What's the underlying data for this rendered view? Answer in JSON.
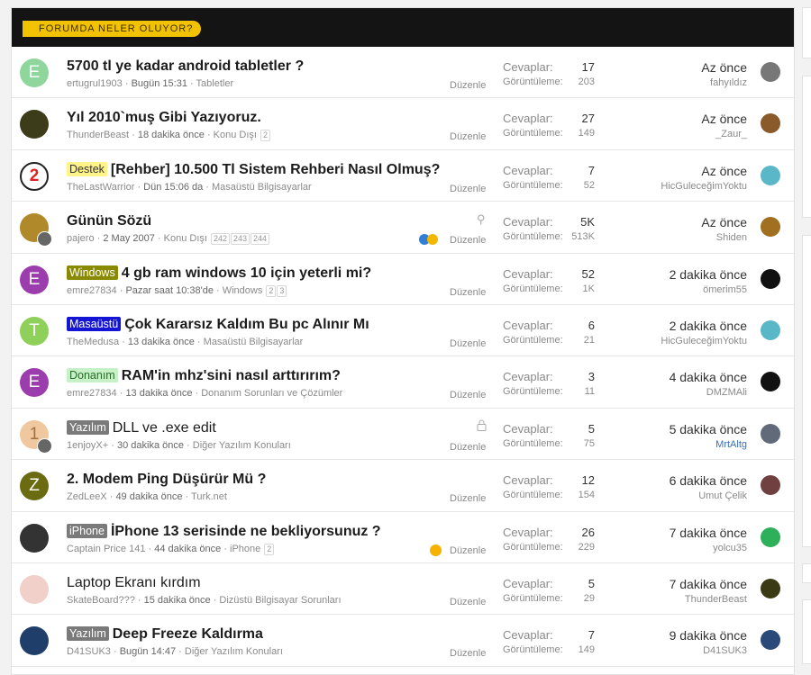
{
  "header": {
    "title": "FORUMDA NELER OLUYOR?"
  },
  "labels": {
    "replies": "Cevaplar:",
    "views": "Görüntüleme:",
    "edit": "Düzenle"
  },
  "threads": [
    {
      "prefix": "",
      "title": "5700 tl ye kadar android tabletler ?",
      "author": "ertugrul1903",
      "when": "Bugün 15:31",
      "forum": "Tabletler",
      "pages": [],
      "replies": "17",
      "views": "203",
      "last_time": "Az önce",
      "last_user": "fahyıldız",
      "avatar_letter": "E"
    },
    {
      "prefix": "",
      "title": "Yıl 2010`muş Gibi Yazıyoruz.",
      "author": "ThunderBeast",
      "when": "18 dakika önce",
      "forum": "Konu Dışı",
      "pages": [
        "2"
      ],
      "replies": "27",
      "views": "149",
      "last_time": "Az önce",
      "last_user": "_Zaur_",
      "avatar_letter": ""
    },
    {
      "prefix": "Destek",
      "title": "[Rehber] 10.500 Tl Sistem Rehberi Nasıl Olmuş?",
      "author": "TheLastWarrior",
      "when": "Dün 15:06 da",
      "forum": "Masaüstü Bilgisayarlar",
      "pages": [],
      "replies": "7",
      "views": "52",
      "last_time": "Az önce",
      "last_user": "HicGuleceğimYoktu",
      "avatar_letter": "2"
    },
    {
      "prefix": "",
      "title": "Günün Sözü",
      "author": "pajero",
      "when": "2 May 2007",
      "forum": "Konu Dışı",
      "pages": [
        "242",
        "243",
        "244"
      ],
      "replies": "5K",
      "views": "513K",
      "last_time": "Az önce",
      "last_user": "Shiden",
      "avatar_letter": ""
    },
    {
      "prefix": "Windows",
      "title": "4 gb ram windows 10 için yeterli mi?",
      "author": "emre27834",
      "when": "Pazar saat 10:38'de",
      "forum": "Windows",
      "pages": [
        "2",
        "3"
      ],
      "replies": "52",
      "views": "1K",
      "last_time": "2 dakika önce",
      "last_user": "ömerim55",
      "avatar_letter": "E"
    },
    {
      "prefix": "Masaüstü",
      "title": "Çok Kararsız Kaldım Bu pc Alınır Mı",
      "author": "TheMedusa",
      "when": "13 dakika önce",
      "forum": "Masaüstü Bilgisayarlar",
      "pages": [],
      "replies": "6",
      "views": "21",
      "last_time": "2 dakika önce",
      "last_user": "HicGuleceğimYoktu",
      "avatar_letter": "T"
    },
    {
      "prefix": "Donanım",
      "title": "RAM'in mhz'sini nasıl arttırırım?",
      "author": "emre27834",
      "when": "13 dakika önce",
      "forum": "Donanım Sorunları ve Çözümler",
      "pages": [],
      "replies": "3",
      "views": "11",
      "last_time": "4 dakika önce",
      "last_user": "DMZMAli",
      "avatar_letter": "E"
    },
    {
      "prefix": "Yazılım",
      "title": "DLL ve .exe edit",
      "author": "1enjoyX+",
      "when": "30 dakika önce",
      "forum": "Diğer Yazılım Konuları",
      "pages": [],
      "replies": "5",
      "views": "75",
      "last_time": "5 dakika önce",
      "last_user": "MrtAltg",
      "avatar_letter": "1"
    },
    {
      "prefix": "",
      "title": "2. Modem Ping Düşürür Mü ?",
      "author": "ZedLeeX",
      "when": "49 dakika önce",
      "forum": "Turk.net",
      "pages": [],
      "replies": "12",
      "views": "154",
      "last_time": "6 dakika önce",
      "last_user": "Umut Çelik",
      "avatar_letter": "Z"
    },
    {
      "prefix": "iPhone",
      "title": "İPhone 13 serisinde ne bekliyorsunuz ?",
      "author": "Captain Price 141",
      "when": "44 dakika önce",
      "forum": "iPhone",
      "pages": [
        "2"
      ],
      "replies": "26",
      "views": "229",
      "last_time": "7 dakika önce",
      "last_user": "yolcu35",
      "avatar_letter": ""
    },
    {
      "prefix": "",
      "title": "Laptop Ekranı kırdım",
      "author": "SkateBoard???",
      "when": "15 dakika önce",
      "forum": "Dizüstü Bilgisayar Sorunları",
      "pages": [],
      "replies": "5",
      "views": "29",
      "last_time": "7 dakika önce",
      "last_user": "ThunderBeast",
      "avatar_letter": ""
    },
    {
      "prefix": "Yazılım",
      "title": "Deep Freeze Kaldırma",
      "author": "D41SUK3",
      "when": "Bugün 14:47",
      "forum": "Diğer Yazılım Konuları",
      "pages": [],
      "replies": "7",
      "views": "149",
      "last_time": "9 dakika önce",
      "last_user": "D41SUK3",
      "avatar_letter": ""
    }
  ],
  "colors": {
    "header_bg": "#141414",
    "badge": "#f2c200",
    "link_blue": "#3a6fb7"
  }
}
